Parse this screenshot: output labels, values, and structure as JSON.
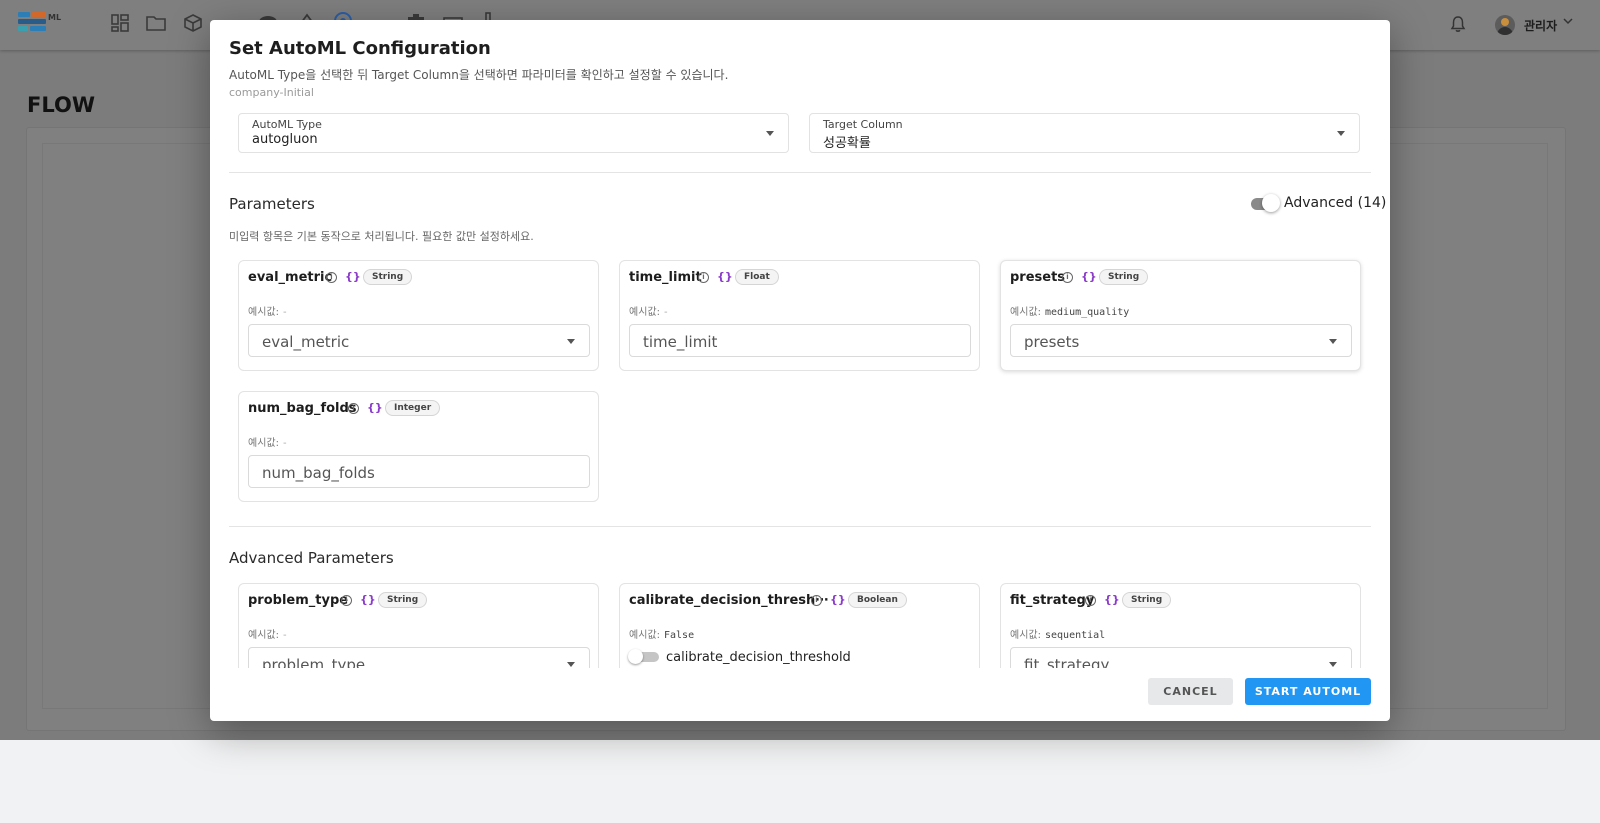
{
  "app": {
    "logo_suffix": "ML",
    "user_name": "관리자",
    "page_title": "FLOW",
    "nav_icons": [
      "dashboard-icon",
      "folder-icon",
      "cube-icon",
      "person-icon",
      "cloud-icon",
      "pie-icon",
      "target-icon",
      "grid-icon",
      "puzzle-icon",
      "monitor-icon",
      "flask-icon"
    ]
  },
  "modal": {
    "title": "Set AutoML Configuration",
    "subtitle": "AutoML Type을 선택한 뒤 Target Column을 선택하면 파라미터를 확인하고 설정할 수 있습니다.",
    "project": "company-Initial",
    "automl_type": {
      "label": "AutoML Type",
      "value": "autogluon"
    },
    "target_column": {
      "label": "Target Column",
      "value": "성공확률"
    },
    "parameters": {
      "title": "Parameters",
      "hint": "미입력 항목은 기본 동작으로 처리됩니다. 필요한 값만 설정하세요.",
      "advanced_toggle": {
        "label": "Advanced (14)",
        "on": true
      },
      "example_prefix": "예시값:",
      "items": [
        {
          "name": "eval_metric",
          "type": "String",
          "example": "-",
          "control": "select",
          "placeholder": "eval_metric"
        },
        {
          "name": "time_limit",
          "type": "Float",
          "example": "-",
          "control": "input",
          "placeholder": "time_limit"
        },
        {
          "name": "presets",
          "type": "String",
          "example": "medium_quality",
          "control": "select",
          "placeholder": "presets"
        },
        {
          "name": "num_bag_folds",
          "type": "Integer",
          "example": "-",
          "control": "input",
          "placeholder": "num_bag_folds"
        }
      ]
    },
    "advanced_parameters": {
      "title": "Advanced Parameters",
      "items": [
        {
          "name": "problem_type",
          "type": "String",
          "example": "-",
          "control": "select",
          "placeholder": "problem_type"
        },
        {
          "name": "calibrate_decision_thresh⋯",
          "type": "Boolean",
          "example": "False",
          "control": "switch",
          "placeholder": "calibrate_decision_threshold"
        },
        {
          "name": "fit_strategy",
          "type": "String",
          "example": "sequential",
          "control": "select",
          "placeholder": "fit_strategy"
        }
      ]
    },
    "buttons": {
      "cancel": "CANCEL",
      "start": "START AUTOML"
    }
  },
  "colors": {
    "primary": "#2196f3",
    "code_icon": "#8a3ac9",
    "overlay": "#7c7c7c"
  }
}
